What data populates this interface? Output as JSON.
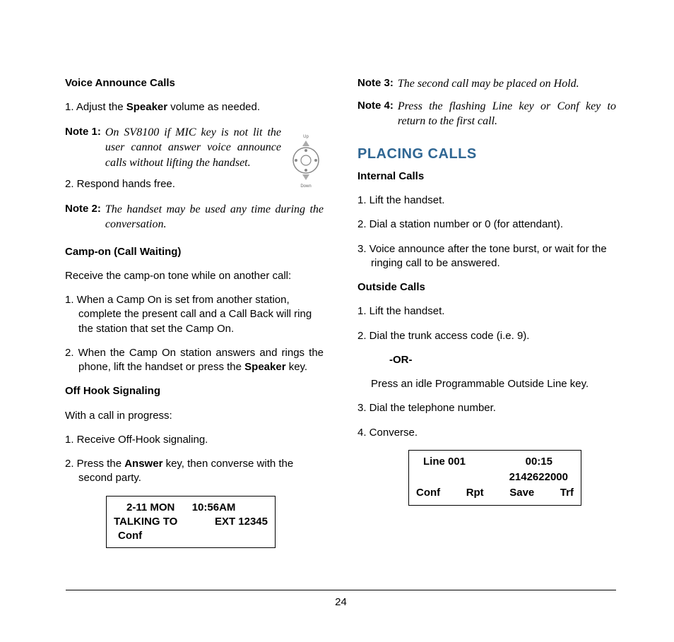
{
  "page_number": "24",
  "left": {
    "h_voice": "Voice Announce Calls",
    "voice1_pre": "1. Adjust the ",
    "voice1_bold": "Speaker",
    "voice1_post": " volume as needed.",
    "note1_lbl": "Note 1:",
    "note1_body": "On SV8100 if MIC key is not lit the user cannot answer voice announce calls without lifting the handset.",
    "voice2": "2. Respond hands free.",
    "note2_lbl": "Note 2:",
    "note2_body": "The handset may be used any time during the conversation.",
    "nav_up": "Up",
    "nav_down": "Down",
    "h_camp": "Camp-on (Call Waiting)",
    "camp_intro": "Receive the camp-on tone while on another call:",
    "camp1": "1. When a Camp On is set from another station, complete the present call and a Call Back will ring the station that set the Camp On.",
    "camp2_pre": "2. When the Camp On station answers and rings the phone, lift the handset or press the ",
    "camp2_bold": "Speaker",
    "camp2_post": " key.",
    "h_off": "Off Hook Signaling",
    "off_intro": "With a call in progress:",
    "off1": "1. Receive Off-Hook signaling.",
    "off2_pre": "2. Press the ",
    "off2_bold": "Answer",
    "off2_post": " key, then converse with the second party.",
    "disp1_a": "2-11 MON",
    "disp1_b": "10:56AM",
    "disp2_a": "TALKING TO",
    "disp2_b": "EXT 12345",
    "disp3": "Conf"
  },
  "right": {
    "note3_lbl": "Note 3:",
    "note3_body": "The second call may be placed on Hold.",
    "note4_lbl": "Note 4:",
    "note4_body": "Press the flashing Line key or Conf key to return to the first call.",
    "h_section": "PLACING CALLS",
    "h_internal": "Internal Calls",
    "int1": "1. Lift the handset.",
    "int2": "2. Dial a station number or 0 (for attendant).",
    "int3": "3. Voice announce after the tone burst, or wait for the ringing call to be answered.",
    "h_outside": "Outside Calls",
    "out1": "1. Lift the handset.",
    "out2": "2. Dial the trunk access code (i.e. 9).",
    "or": "-OR-",
    "out2b": "Press an idle Programmable Outside Line key.",
    "out3": "3. Dial the telephone number.",
    "out4": "4. Converse.",
    "disp1_a": "Line 001",
    "disp1_b": "00:15",
    "disp2": "2142622000",
    "disp3_a": "Conf",
    "disp3_b": "Rpt",
    "disp3_c": "Save",
    "disp3_d": "Trf"
  }
}
